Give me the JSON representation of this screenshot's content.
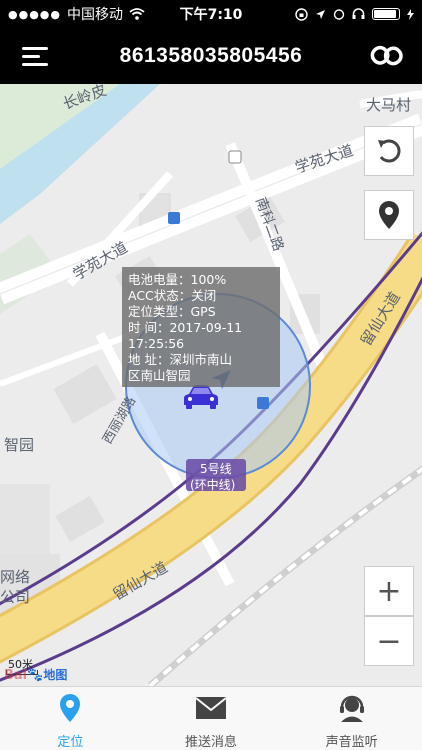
{
  "status_bar": {
    "signal": "●●●●●",
    "carrier": "中国移动",
    "time": "下午7:10"
  },
  "nav": {
    "title": "861358035805456"
  },
  "map": {
    "road_labels": [
      "长岭皮",
      "学苑大道",
      "学苑大道",
      "南科二路",
      "留仙大道",
      "留仙大道",
      "大马村",
      "智园",
      "网络",
      "公司",
      "西丽湖路"
    ],
    "metro_label": "5号线",
    "metro_sub": "(环中线)",
    "scale": "50米",
    "logo": "Bai",
    "logo_suffix": "地图"
  },
  "info": {
    "battery": "电池电量：100%",
    "acc": "ACC状态：关闭",
    "position_type": "定位类型：GPS",
    "time_line1": "时        间：2017-09-11",
    "time_line2": "17:25:56",
    "address_line1": "地        址：深圳市南山",
    "address_line2": "区南山智园"
  },
  "controls": {
    "zoom_in": "+",
    "zoom_out": "−"
  },
  "tabs": [
    {
      "label": "定位",
      "active": true,
      "icon": "location-pin-icon"
    },
    {
      "label": "推送消息",
      "active": false,
      "icon": "envelope-icon"
    },
    {
      "label": "声音监听",
      "active": false,
      "icon": "headset-icon"
    }
  ],
  "colors": {
    "accent": "#2aa1f0",
    "car": "#3b2fd6",
    "circle_fill": "#a9c9f5",
    "road_main": "#f5d77a",
    "metro_line": "#5b3c8c"
  }
}
